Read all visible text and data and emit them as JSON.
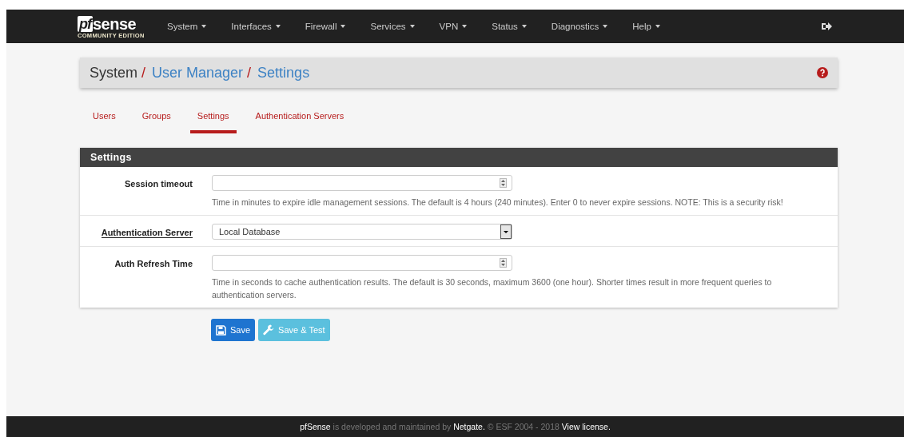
{
  "brand": {
    "mark": "pf",
    "name": "sense",
    "edition": "COMMUNITY EDITION"
  },
  "nav": [
    {
      "label": "System"
    },
    {
      "label": "Interfaces"
    },
    {
      "label": "Firewall"
    },
    {
      "label": "Services"
    },
    {
      "label": "VPN"
    },
    {
      "label": "Status"
    },
    {
      "label": "Diagnostics"
    },
    {
      "label": "Help"
    }
  ],
  "breadcrumb": [
    {
      "text": "System",
      "link": false,
      "separator": "/"
    },
    {
      "text": "User Manager",
      "link": true,
      "separator": "/"
    },
    {
      "text": "Settings",
      "link": true
    }
  ],
  "tabs": [
    {
      "label": "Users",
      "selected": false
    },
    {
      "label": "Groups",
      "selected": false
    },
    {
      "label": "Settings",
      "selected": true
    },
    {
      "label": "Authentication Servers",
      "selected": false
    }
  ],
  "panel": {
    "title": "Settings",
    "rows": [
      {
        "kind": "number",
        "label": "Session timeout",
        "label_link": false,
        "help": "Time in minutes to expire idle management sessions. The default is 4 hours (240 minutes). Enter 0 to never expire sessions. NOTE: This is a security risk!"
      },
      {
        "kind": "select",
        "label": "Authentication Server",
        "label_link": true,
        "value": "Local Database"
      },
      {
        "kind": "number",
        "label": "Auth Refresh Time",
        "label_link": false,
        "help": "Time in seconds to cache authentication results. The default is 30 seconds, maximum 3600 (one hour). Shorter times result in more frequent queries to authentication servers."
      }
    ]
  },
  "buttons": [
    {
      "label": "Save",
      "kind": "primary"
    },
    {
      "label": "Save & Test",
      "kind": "info"
    }
  ],
  "footer": "**pfSense** is developed and maintained by **Netgate.** © ESF 2004 - 2018 **View license.**"
}
